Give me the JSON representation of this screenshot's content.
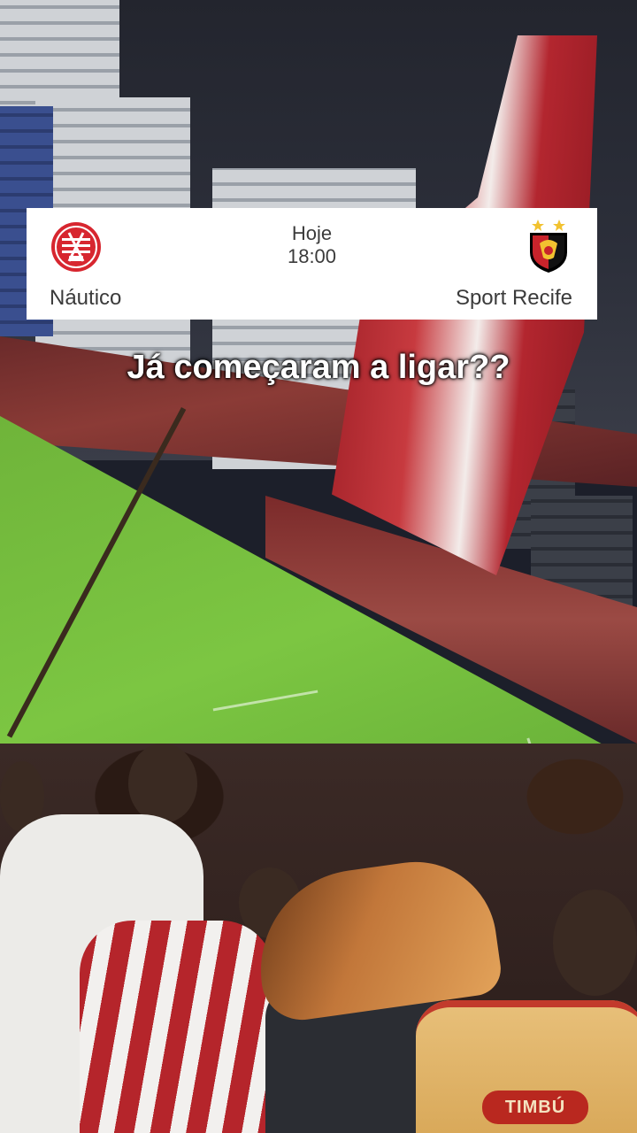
{
  "match": {
    "day": "Hoje",
    "time": "18:00",
    "home_team": "Náutico",
    "away_team": "Sport Recife",
    "home_crest_icon": "nautico-crest-icon",
    "away_crest_icon": "sport-recife-crest-icon",
    "home_crest_colors": {
      "primary": "#d7262f",
      "secondary": "#ffffff"
    },
    "away_crest_colors": {
      "primary": "#c8232b",
      "secondary": "#000000",
      "star": "#f2c230"
    }
  },
  "caption": {
    "text": "Já começaram a ligar??"
  },
  "background": {
    "shirt_logo_text": "TIMBÚ"
  }
}
